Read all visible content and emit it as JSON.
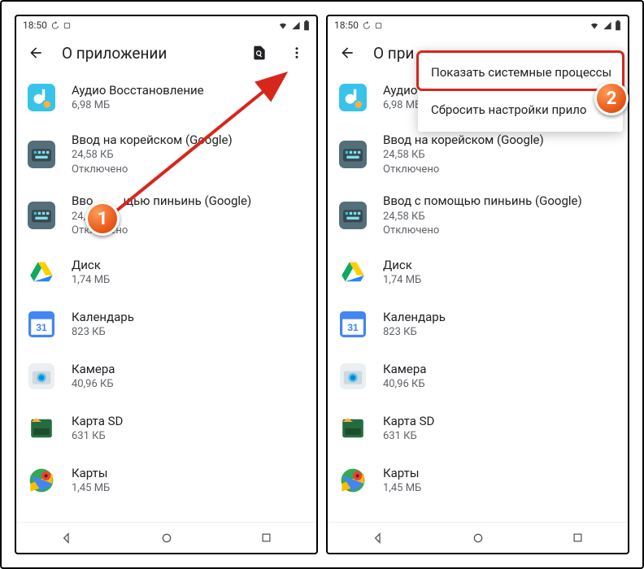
{
  "status": {
    "time": "18:50",
    "icons": [
      "history-icon",
      "alarm-icon"
    ]
  },
  "appbar": {
    "title": "О приложении",
    "title_truncated": "О при"
  },
  "popup": {
    "item1": "Показать системные процессы",
    "item2": "Сбросить настройки прило"
  },
  "apps": [
    {
      "name": "Аудио Восстановление",
      "sub1": "6,98 МБ",
      "sub2": "",
      "icon": "audio-recovery"
    },
    {
      "name": "Ввод на корейском (Google)",
      "sub1": "24,58 КБ",
      "sub2": "Отключено",
      "icon": "keyboard"
    },
    {
      "name": "Ввод с помощью пиньинь (Google)",
      "sub1": "24,58 КБ",
      "sub2": "Отключено",
      "icon": "keyboard-pinyin"
    },
    {
      "name": "Диск",
      "sub1": "1,74 МБ",
      "sub2": "",
      "icon": "drive"
    },
    {
      "name": "Календарь",
      "sub1": "823 КБ",
      "sub2": "",
      "icon": "calendar"
    },
    {
      "name": "Камера",
      "sub1": "40,96 КБ",
      "sub2": "",
      "icon": "camera"
    },
    {
      "name": "Карта SD",
      "sub1": "631 КБ",
      "sub2": "",
      "icon": "sdcard"
    },
    {
      "name": "Карты",
      "sub1": "1,45 МБ",
      "sub2": "",
      "icon": "maps"
    }
  ],
  "apps_left_overrides": {
    "2": {
      "name": "Ввод на корейском (Google)"
    },
    "3_sub1": "24,58       ",
    "pinyin_left": {
      "prefix": "Вво",
      "suffix": "щью пиньинь (Google)"
    }
  },
  "badges": {
    "b1": "1",
    "b2": "2"
  }
}
